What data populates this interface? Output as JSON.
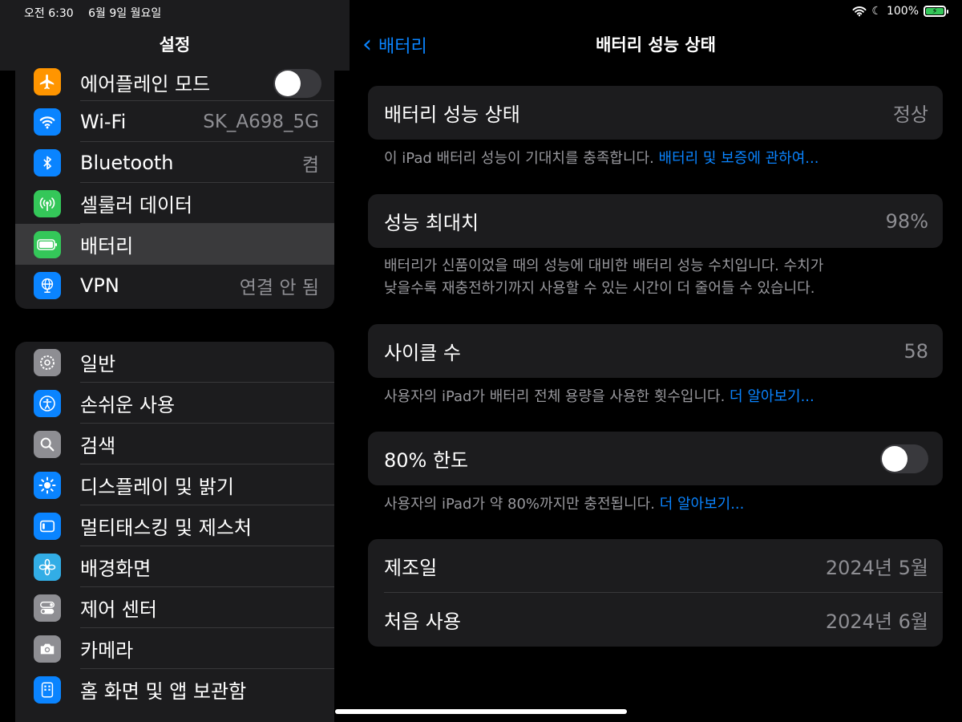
{
  "status": {
    "time": "오전 6:30",
    "date": "6월 9일 월요일",
    "battery_pct": "100%"
  },
  "sidebar": {
    "title": "설정",
    "group1": [
      {
        "label": "에어플레인 모드",
        "value": "",
        "icon": "airplane-icon",
        "color": "#ff9500",
        "toggle": false
      },
      {
        "label": "Wi-Fi",
        "value": "SK_A698_5G",
        "icon": "wifi-icon",
        "color": "#0a84ff"
      },
      {
        "label": "Bluetooth",
        "value": "켬",
        "icon": "bluetooth-icon",
        "color": "#0a84ff"
      },
      {
        "label": "셀룰러 데이터",
        "value": "",
        "icon": "cellular-icon",
        "color": "#34c759"
      },
      {
        "label": "배터리",
        "value": "",
        "icon": "battery-icon",
        "color": "#34c759",
        "selected": true
      },
      {
        "label": "VPN",
        "value": "연결 안 됨",
        "icon": "vpn-icon",
        "color": "#0a84ff"
      }
    ],
    "group2": [
      {
        "label": "일반",
        "icon": "gear-icon",
        "color": "#8e8e93"
      },
      {
        "label": "손쉬운 사용",
        "icon": "accessibility-icon",
        "color": "#0a84ff"
      },
      {
        "label": "검색",
        "icon": "search-icon",
        "color": "#8e8e93"
      },
      {
        "label": "디스플레이 및 밝기",
        "icon": "brightness-icon",
        "color": "#0a84ff"
      },
      {
        "label": "멀티태스킹 및 제스처",
        "icon": "multitasking-icon",
        "color": "#0a84ff"
      },
      {
        "label": "배경화면",
        "icon": "wallpaper-icon",
        "color": "#32ade6"
      },
      {
        "label": "제어 센터",
        "icon": "control-center-icon",
        "color": "#8e8e93"
      },
      {
        "label": "카메라",
        "icon": "camera-icon",
        "color": "#8e8e93"
      },
      {
        "label": "홈 화면 및 앱 보관함",
        "icon": "home-screen-icon",
        "color": "#0a84ff"
      }
    ]
  },
  "detail": {
    "back_label": "배터리",
    "title": "배터리 성능 상태",
    "health": {
      "label": "배터리 성능 상태",
      "value": "정상"
    },
    "health_note": "이 iPad 배터리 성능이 기대치를 충족합니다. ",
    "health_link": "배터리 및 보증에 관하여...",
    "capacity": {
      "label": "성능 최대치",
      "value": "98%"
    },
    "capacity_note_1": "배터리가 신품이었을 때의 성능에 대비한 배터리 성능 수치입니다. 수치가",
    "capacity_note_2": "낮을수록 재충전하기까지 사용할 수 있는 시간이 더 줄어들 수 있습니다.",
    "cycles": {
      "label": "사이클 수",
      "value": "58"
    },
    "cycles_note": "사용자의 iPad가 배터리 전체 용량을 사용한 횟수입니다. ",
    "cycles_link": "더 알아보기...",
    "limit": {
      "label": "80% 한도",
      "on": false
    },
    "limit_note": "사용자의 iPad가 약 80%까지만 충전됩니다. ",
    "limit_link": "더 알아보기...",
    "manufactured": {
      "label": "제조일",
      "value": "2024년 5월"
    },
    "first_use": {
      "label": "처음 사용",
      "value": "2024년 6월"
    }
  }
}
